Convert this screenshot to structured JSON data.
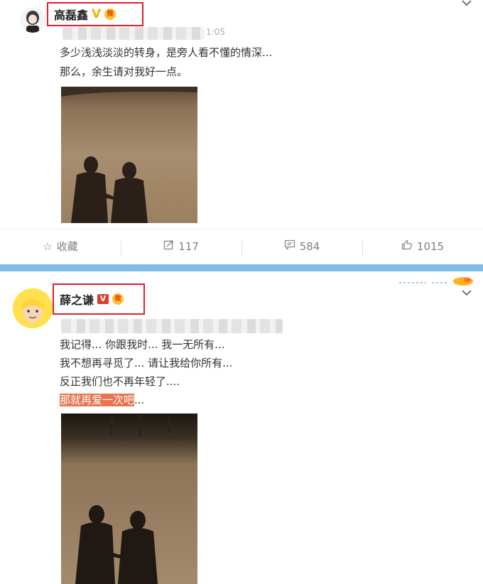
{
  "post1": {
    "username": "高磊鑫",
    "verified_mark": "V",
    "badge_glyph": "微",
    "time_partial": "1:05",
    "lines": [
      "多少浅浅淡淡的转身，是旁人看不懂的情深...",
      "那么，余生请对我好一点。"
    ],
    "actions": {
      "favorite_label": "收藏",
      "repost_count": "117",
      "comment_count": "584",
      "like_count": "1015"
    }
  },
  "post2": {
    "username": "薛之谦",
    "verified_mark": "V",
    "badge_glyph": "微",
    "lines": [
      "我记得... 你跟我时... 我一无所有...",
      "我不想再寻觅了... 请让我给你所有...",
      "反正我们也不再年轻了...."
    ],
    "highlight_text": "那就再爱一次吧",
    "highlight_tail": "..."
  },
  "icons": {
    "chevron": "chevron-down-icon",
    "favorite": "star-outline-icon",
    "repost": "repost-icon",
    "comment": "comment-icon",
    "like": "thumb-up-icon"
  },
  "colors": {
    "highlight_box": "#e0202a",
    "divider": "#7fbde8",
    "verified_yellow": "#f4b000",
    "verified_red": "#e03a2a",
    "text_highlight": "#e8734f"
  }
}
